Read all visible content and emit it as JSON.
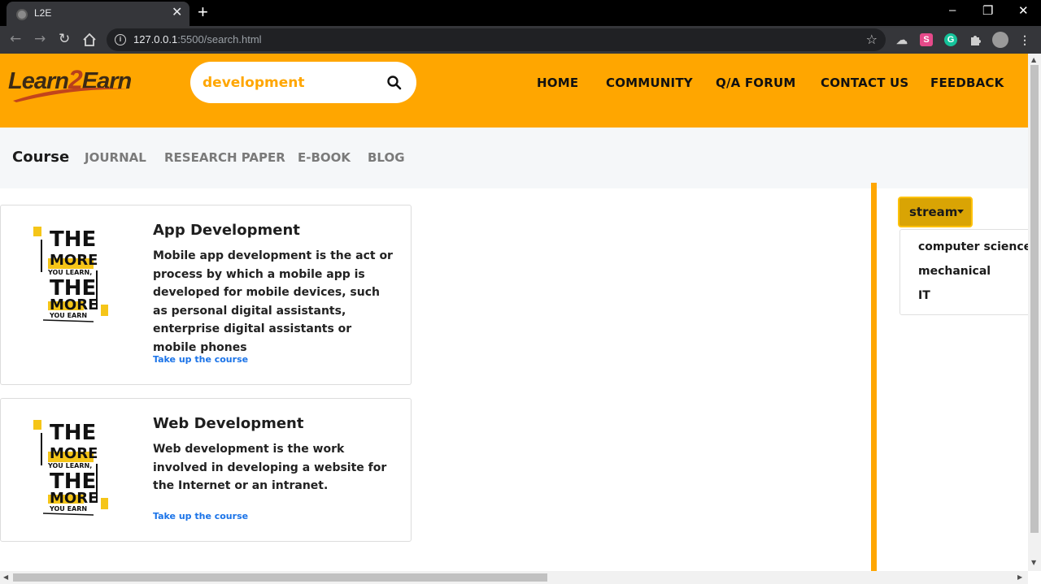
{
  "browser": {
    "tab_title": "L2E",
    "tab_close": "✕",
    "new_tab": "+",
    "url_host": "127.0.0.1",
    "url_rest": ":5500/search.html",
    "window_controls": [
      "–",
      "❐",
      "✕"
    ],
    "icons": [
      "back-icon",
      "forward-icon",
      "reload-icon",
      "home-icon",
      "info-icon",
      "star-icon",
      "cloud-icon",
      "grammarly-s-icon",
      "grammarly-g-icon",
      "puzzle-icon",
      "profile-avatar",
      "menu-dots-icon"
    ]
  },
  "header": {
    "logo_part1": "Learn",
    "logo_part2": "2",
    "logo_part3": "Earn",
    "search_value": "development",
    "nav": [
      "HOME",
      "COMMUNITY",
      "Q/A FORUM",
      "CONTACT US",
      "FEEDBACK"
    ]
  },
  "subnav": {
    "items": [
      "Course",
      "JOURNAL",
      "RESEARCH PAPER",
      "E-BOOK",
      "BLOG"
    ],
    "active": "Course"
  },
  "results": [
    {
      "title": "App Development",
      "description": "Mobile app development is the act or process by which a mobile app is developed for mobile devices, such as personal digital assistants, enterprise digital assistants or mobile phones",
      "link": "Take up the course"
    },
    {
      "title": "Web Development",
      "description": "Web development is the work involved in developing a website for the Internet or an intranet.",
      "link": "Take up the course"
    }
  ],
  "poster": {
    "line1": "THE",
    "line2": "MORE",
    "line3": "YOU LEARN,",
    "line4": "THE",
    "line5": "MORE",
    "line6": "YOU EARN"
  },
  "filter": {
    "button_label": "stream",
    "options": [
      "computer science",
      "mechanical",
      "IT"
    ]
  },
  "colors": {
    "brand_orange": "#ffa600",
    "stream_button": "#d9a404",
    "link_blue": "#1a73e8"
  }
}
